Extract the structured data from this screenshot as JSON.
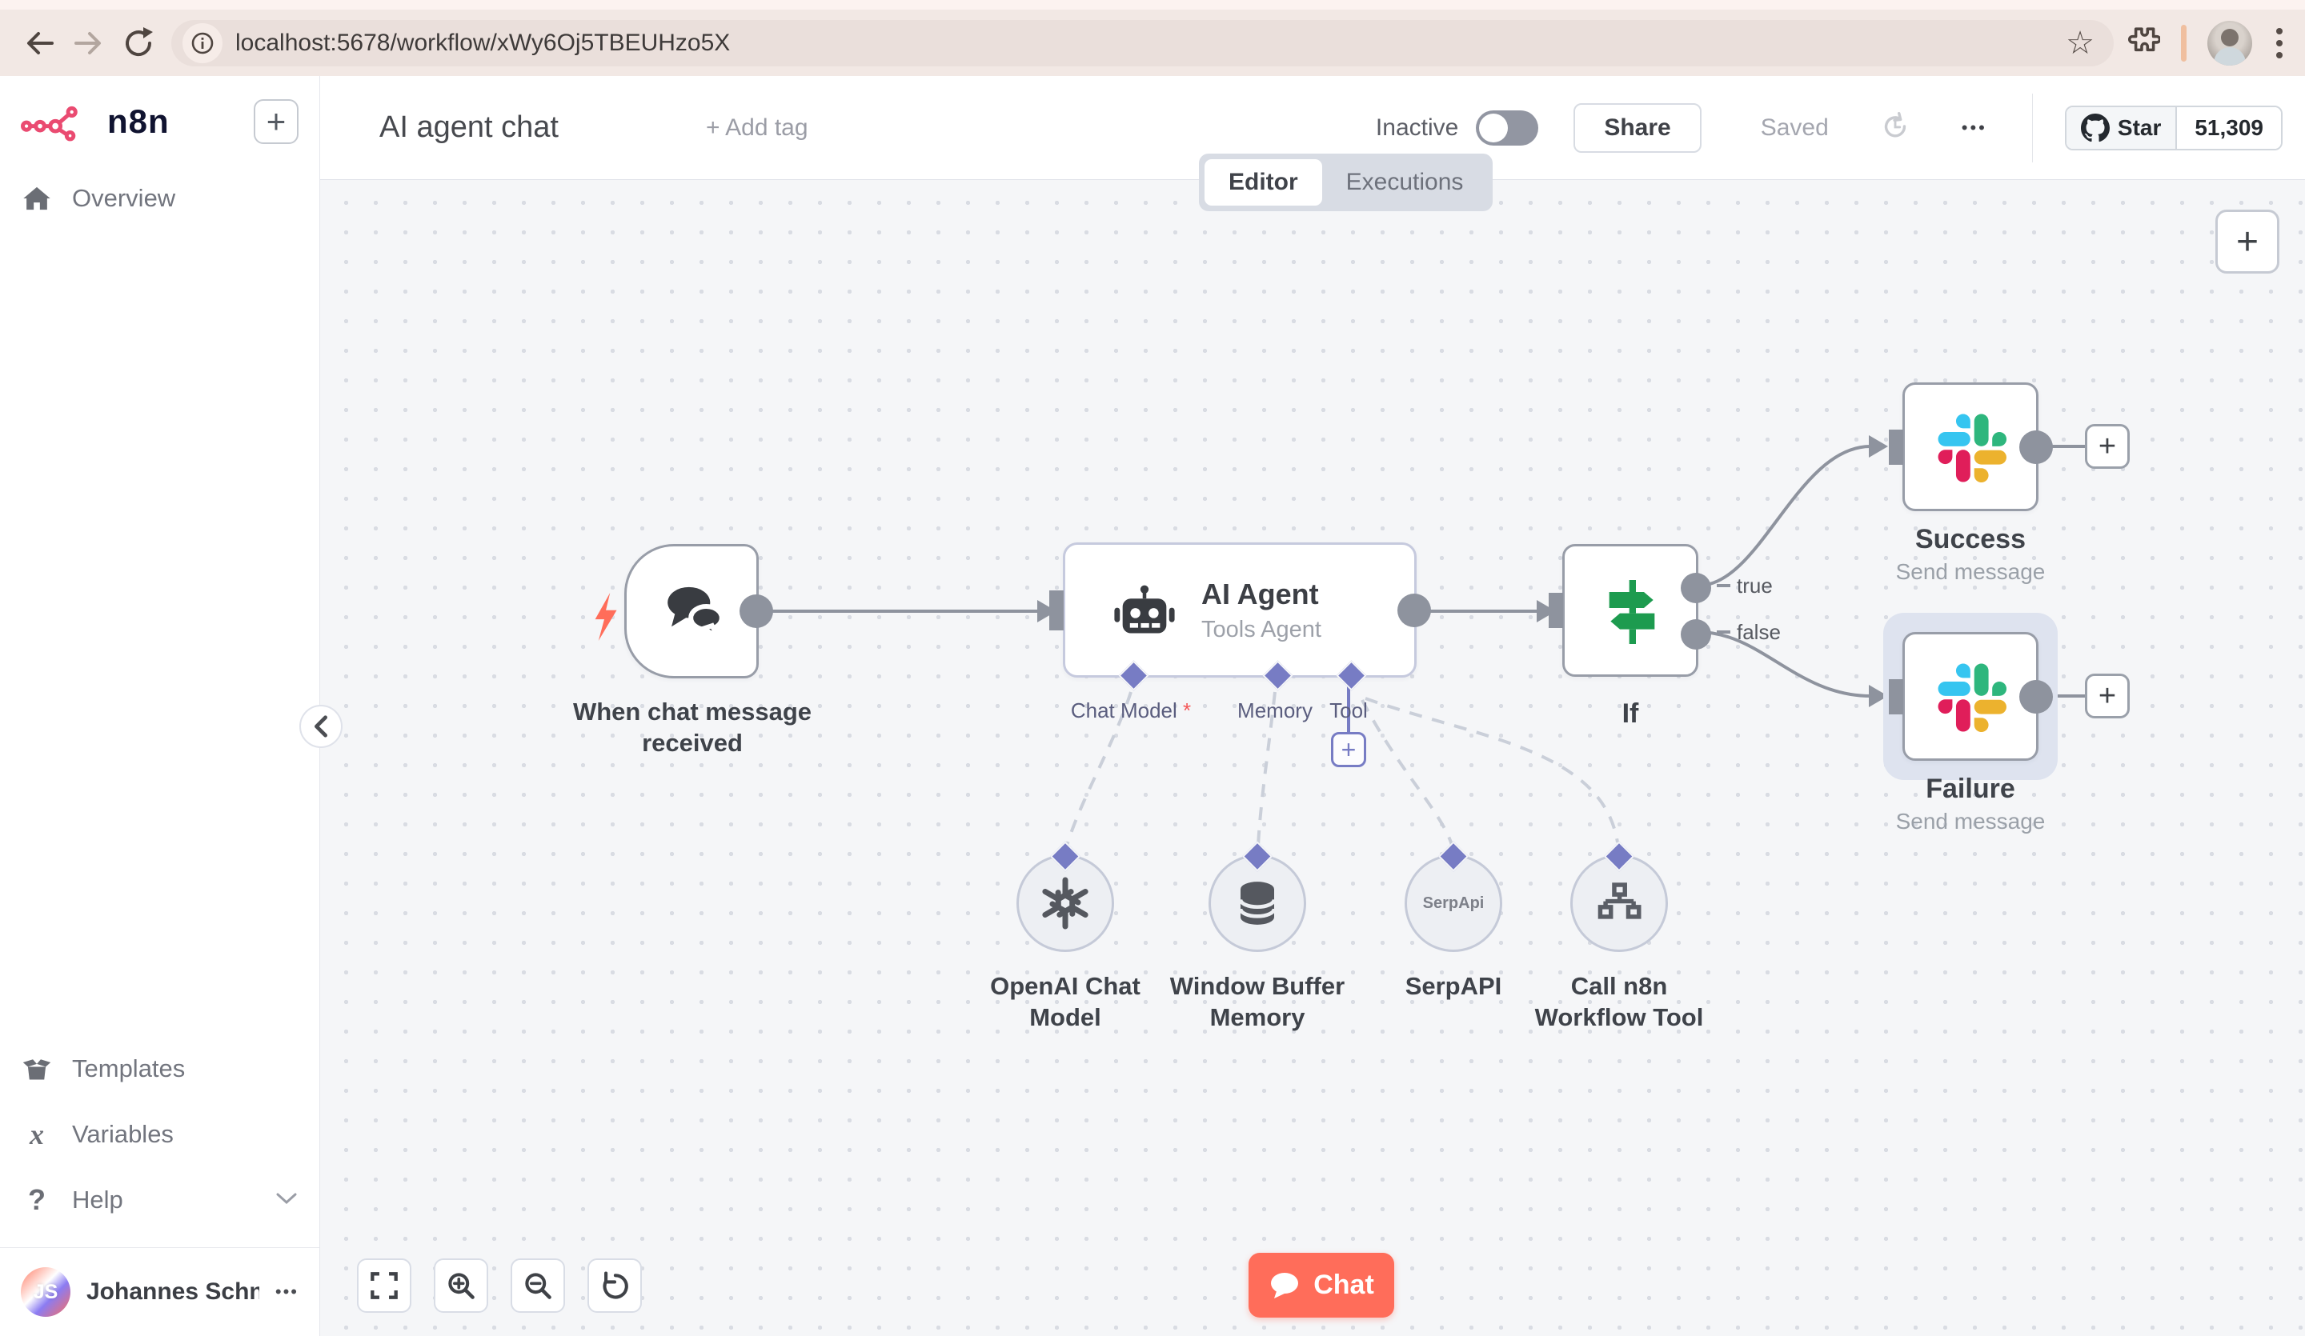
{
  "browser": {
    "url": "localhost:5678/workflow/xWy6Oj5TBEUHzo5X"
  },
  "glyphs": {
    "plus": "+"
  },
  "sidebar": {
    "logo": "n8n",
    "items": [
      {
        "label": "Overview"
      }
    ],
    "footer_items": [
      {
        "label": "Templates"
      },
      {
        "label": "Variables"
      },
      {
        "label": "Help"
      }
    ],
    "user": {
      "initials": "JS",
      "name": "Johannes Schn...",
      "menu": "•••"
    }
  },
  "header": {
    "title": "AI agent chat",
    "add_tag": "+ Add tag",
    "activation": "Inactive",
    "share": "Share",
    "saved": "Saved",
    "more": "•••",
    "github": {
      "label": "Star",
      "count": "51,309"
    }
  },
  "tabs": {
    "editor": "Editor",
    "executions": "Executions"
  },
  "workflow": {
    "trigger": {
      "label": "When chat message received"
    },
    "agent": {
      "title": "AI Agent",
      "subtitle": "Tools Agent",
      "ports": [
        {
          "label": "Chat Model",
          "required": "*"
        },
        {
          "label": "Memory"
        },
        {
          "label": "Tool"
        }
      ]
    },
    "if": {
      "label": "If",
      "outputs": [
        {
          "label": "true"
        },
        {
          "label": "false"
        }
      ]
    },
    "success": {
      "title": "Success",
      "subtitle": "Send message"
    },
    "failure": {
      "title": "Failure",
      "subtitle": "Send message"
    },
    "subnodes": [
      {
        "label": "OpenAI Chat Model"
      },
      {
        "label": "Window Buffer Memory"
      },
      {
        "label": "SerpAPI",
        "badge": "SerpApi"
      },
      {
        "label": "Call n8n Workflow Tool"
      }
    ]
  },
  "controls": {
    "chat": "Chat"
  },
  "colors": {
    "accent": "#ea4b71",
    "chat_button": "#ff6d5a",
    "connector": "#8e939e",
    "port_diamond": "#777cc4",
    "if_icon": "#1d9b4f",
    "canvas": "#f5f6f8"
  }
}
